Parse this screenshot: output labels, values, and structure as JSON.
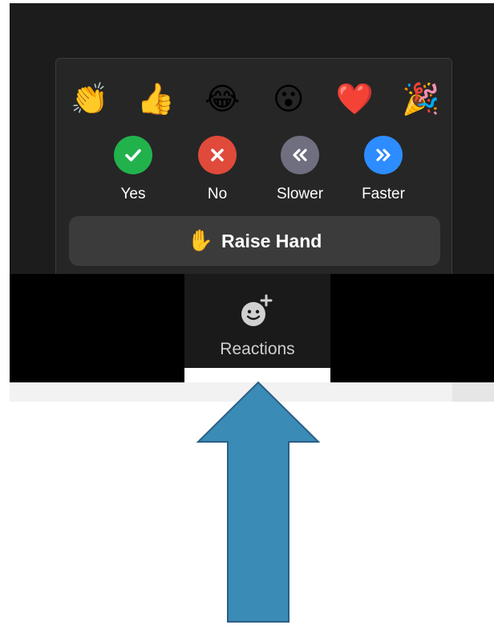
{
  "reactions_popup": {
    "emojis": [
      {
        "name": "clapping-hands",
        "glyph": "👏"
      },
      {
        "name": "thumbs-up",
        "glyph": "👍"
      },
      {
        "name": "tears-of-joy",
        "glyph": "😂"
      },
      {
        "name": "open-mouth",
        "glyph": "😮"
      },
      {
        "name": "red-heart",
        "glyph": "❤️"
      },
      {
        "name": "party-popper",
        "glyph": "🎉"
      }
    ],
    "feedback": [
      {
        "label": "Yes",
        "icon": "check-icon",
        "color": "#22b24c"
      },
      {
        "label": "No",
        "icon": "x-icon",
        "color": "#e04a3b"
      },
      {
        "label": "Slower",
        "icon": "double-chevron-left-icon",
        "color": "#6f6f80"
      },
      {
        "label": "Faster",
        "icon": "double-chevron-right-icon",
        "color": "#2d8cff"
      }
    ],
    "raise_hand": {
      "glyph": "✋",
      "label": "Raise Hand"
    }
  },
  "toolbar": {
    "reactions_label": "Reactions"
  },
  "colors": {
    "popup_bg": "#262626",
    "toolbar_bg": "#1a1a1a",
    "raise_hand_bg": "#3b3b3b",
    "arrow_fill": "#3a8bb6",
    "arrow_stroke": "#2b5f86"
  }
}
